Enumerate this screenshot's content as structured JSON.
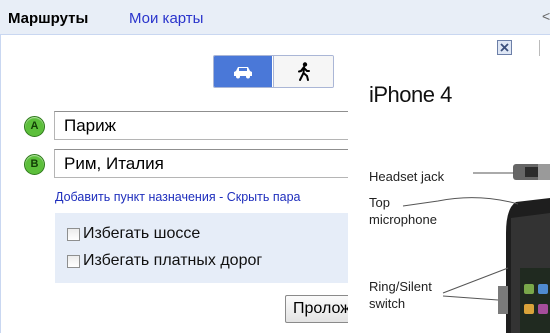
{
  "tabs": {
    "routes": "Маршруты",
    "my_maps": "Мои карты",
    "edge_glyph": "<"
  },
  "travel_modes": [
    {
      "name": "car-icon",
      "selected": true
    },
    {
      "name": "walking-icon",
      "selected": false
    }
  ],
  "waypoints": {
    "a": {
      "marker": "A",
      "value": "Париж"
    },
    "b": {
      "marker": "B",
      "value": "Рим, Италия"
    }
  },
  "links": {
    "add_destination": "Добавить пункт назначения",
    "separator": " - ",
    "hide_options": "Скрыть пара"
  },
  "options": {
    "avoid_highways": "Избегать шоссе",
    "avoid_tolls": "Избегать платных дорог"
  },
  "route_button": "Проложить",
  "diagram": {
    "title": "iPhone 4",
    "labels": {
      "headset_jack": "Headset jack",
      "top_microphone_1": "Top",
      "top_microphone_2": "microphone",
      "ring_silent_1": "Ring/Silent",
      "ring_silent_2": "switch"
    }
  },
  "colors": {
    "tabbar_bg": "#e8eef7",
    "link_blue": "#1f2fbd",
    "marker_green": "#5cbf3b",
    "mode_selected": "#4a78d8",
    "options_bg": "#e6edf8"
  }
}
